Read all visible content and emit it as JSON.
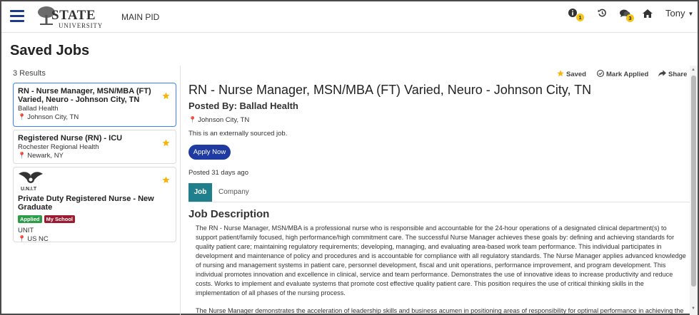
{
  "header": {
    "logo_state": "STATE",
    "logo_university": "UNIVERSITY",
    "main_pid": "MAIN PID",
    "info_badge": "1",
    "messages_badge": "3",
    "user": "Tony"
  },
  "page": {
    "title": "Saved Jobs",
    "results_count": "3 Results"
  },
  "jobs": [
    {
      "title": "RN - Nurse Manager, MSN/MBA (FT) Varied, Neuro - Johnson City, TN",
      "company": "Ballad Health",
      "location": "Johnson City, TN"
    },
    {
      "title": "Registered Nurse (RN) - ICU",
      "company": "Rochester Regional Health",
      "location": "Newark, NY"
    },
    {
      "title": "Private Duty Registered Nurse - New Graduate",
      "logo_text": "U.N.I.T",
      "tag_applied": "Applied",
      "tag_school": "My School",
      "company": "UNIT",
      "location": "US NC"
    }
  ],
  "detail": {
    "saved_label": "Saved",
    "mark_applied_label": "Mark Applied",
    "share_label": "Share",
    "title": "RN - Nurse Manager, MSN/MBA (FT) Varied, Neuro - Johnson City, TN",
    "posted_by": "Posted By: Ballad Health",
    "location": "Johnson City, TN",
    "external_note": "This is an externally sourced job.",
    "apply_label": "Apply Now",
    "posted_ago": "Posted 31 days ago",
    "tab_job": "Job",
    "tab_company": "Company",
    "description_heading": "Job Description",
    "paragraph1": "The RN - Nurse Manager, MSN/MBA is a professional nurse who is responsible and accountable for the 24-hour operations of a designated clinical department(s) to support patient/family focused, high performance/high commitment care. The successful Nurse Manager achieves these goals by: defining and achieving standards for quality patient care; maintaining regulatory requirements; developing, managing, and evaluating area-based work team performance. This individual participates in development and maintenance of policy and procedures and is accountable for compliance with all regulatory standards. The Nurse Manager applies advanced knowledge of nursing and management systems in patient care, personnel development, fiscal and unit operations, performance improvement, and program development. This individual promotes innovation and excellence in clinical, service and team performance. Demonstrates the use of innovative ideas to increase productivity and reduce costs. Works to implement and evaluate systems that promote cost effective quality patient care. This position requires the use of critical thinking skills in the implementation of all phases of the nursing process.",
    "paragraph2": "The Nurse Manager demonstrates the acceleration of leadership skills and business acumen in positioning areas of responsibility for optimal performance in achieving the"
  },
  "colors": {
    "primary": "#1f3aa0",
    "tab_active": "#1f7f8c",
    "star": "#f5b50a",
    "applied": "#2e9d4a",
    "my_school": "#9b1b30"
  }
}
